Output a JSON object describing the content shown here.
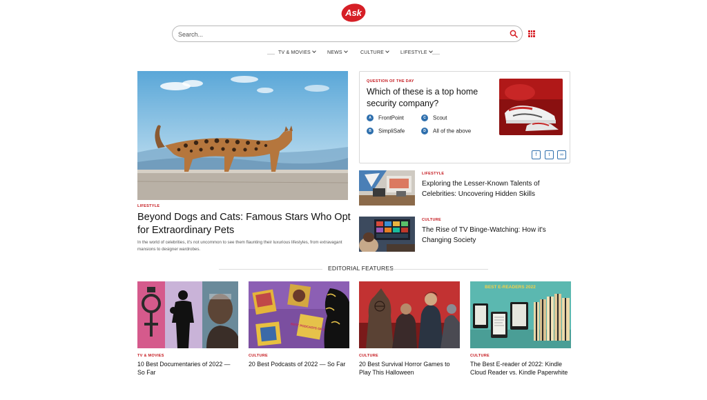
{
  "logo": {
    "text": "Ask",
    "color": "#d61f26"
  },
  "search": {
    "placeholder": "Search...",
    "icon": "search-icon"
  },
  "nav": {
    "items": [
      {
        "label": "TV & MOVIES"
      },
      {
        "label": "NEWS"
      },
      {
        "label": "CULTURE"
      },
      {
        "label": "LIFESTYLE"
      }
    ]
  },
  "hero": {
    "label": "LIFESTYLE",
    "title": "Beyond Dogs and Cats: Famous Stars Who Opt for Extraordinary Pets",
    "description": "In the world of celebrities, it's not uncommon to see them flaunting their luxurious lifestyles, from extravagant mansions to designer wardrobes."
  },
  "qotd": {
    "label": "QUESTION OF THE DAY",
    "question": "Which of these is a top home security company?",
    "options": [
      {
        "letter": "A",
        "text": "FrontPoint"
      },
      {
        "letter": "B",
        "text": "SimpliSafe"
      },
      {
        "letter": "C",
        "text": "Scout"
      },
      {
        "letter": "D",
        "text": "All of the above"
      }
    ],
    "share": [
      {
        "glyph": "f",
        "icon": "facebook-icon"
      },
      {
        "glyph": "t",
        "icon": "twitter-icon"
      },
      {
        "glyph": "∞",
        "icon": "link-icon"
      }
    ]
  },
  "side_stories": [
    {
      "label": "LIFESTYLE",
      "title": "Exploring the Lesser-Known Talents of Celebrities: Uncovering Hidden Skills"
    },
    {
      "label": "CULTURE",
      "title": "The Rise of TV Binge-Watching: How it's Changing Society"
    }
  ],
  "editorial": {
    "heading": "EDITORIAL FEATURES",
    "cards": [
      {
        "label": "TV & MOVIES",
        "title": "10 Best Documentaries of 2022 — So Far"
      },
      {
        "label": "CULTURE",
        "title": "20 Best Podcasts of 2022 — So Far",
        "image_text": "BEST PODCASTS OF 2022"
      },
      {
        "label": "CULTURE",
        "title": "20 Best Survival Horror Games to Play This Halloween"
      },
      {
        "label": "CULTURE",
        "title": "The Best E-reader of 2022: Kindle Cloud Reader vs. Kindle Paperwhite",
        "image_text": "BEST E-READERS 2022"
      }
    ]
  },
  "colors": {
    "accent": "#d61f26",
    "label_red": "#c4161c",
    "option_blue": "#2e6fad"
  }
}
